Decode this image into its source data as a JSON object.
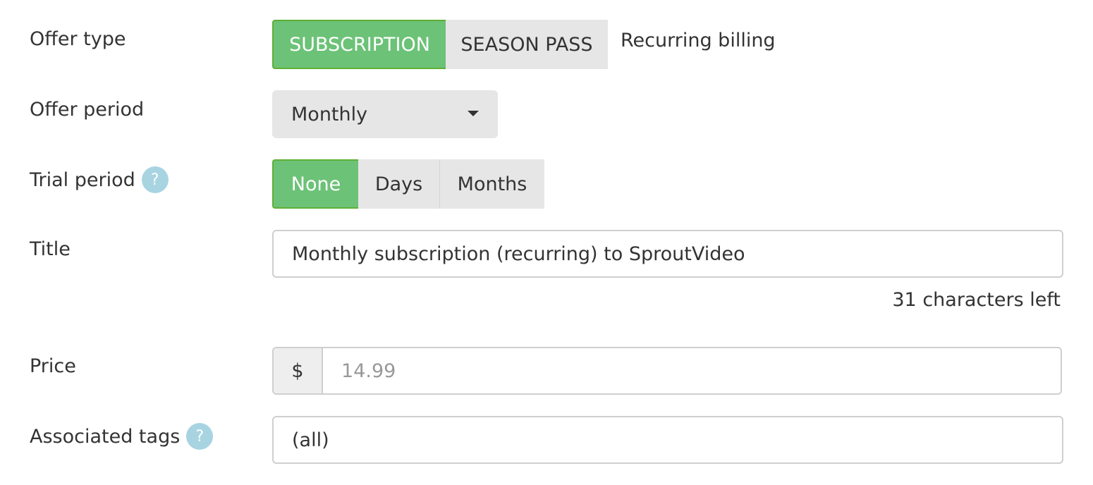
{
  "offer_type": {
    "label": "Offer type",
    "options": [
      "SUBSCRIPTION",
      "SEASON PASS"
    ],
    "selected": "SUBSCRIPTION",
    "note": "Recurring billing"
  },
  "offer_period": {
    "label": "Offer period",
    "selected": "Monthly"
  },
  "trial_period": {
    "label": "Trial period",
    "help": "?",
    "options": [
      "None",
      "Days",
      "Months"
    ],
    "selected": "None"
  },
  "title": {
    "label": "Title",
    "value": "Monthly subscription (recurring) to SproutVideo",
    "chars_left": "31 characters left"
  },
  "price": {
    "label": "Price",
    "currency": "$",
    "placeholder": "14.99"
  },
  "associated_tags": {
    "label": "Associated tags",
    "help": "?",
    "value": "(all)"
  },
  "colors": {
    "active": "#6cc277",
    "active_border": "#5eb035",
    "inactive": "#e6e6e6",
    "help": "#a8d4e2"
  }
}
